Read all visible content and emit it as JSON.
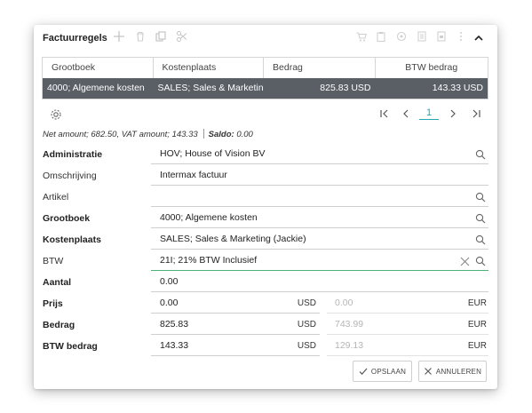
{
  "header": {
    "title": "Factuurregels",
    "left_icons": [
      "plus-icon",
      "trash-icon",
      "copy-icon",
      "scissors-icon"
    ],
    "right_icons": [
      "cart-icon",
      "clipboard-icon",
      "eye-icon",
      "note-icon",
      "doc-icon",
      "more-icon"
    ],
    "collapse_icon": "chevron-up-icon"
  },
  "grid": {
    "columns": [
      "Grootboek",
      "Kostenplaats",
      "Bedrag",
      "BTW bedrag"
    ],
    "rows": [
      {
        "grootboek": "4000; Algemene kosten",
        "kostenplaats": "SALES; Sales & Marketing (",
        "bedrag": "825.83 USD",
        "btw_bedrag": "143.33 USD"
      }
    ]
  },
  "pager": {
    "page": "1"
  },
  "summary": {
    "net": "Net amount; 682.50, VAT amount; 143.33",
    "saldo_label": "Saldo:",
    "saldo_value": "0.00"
  },
  "form": {
    "administratie": {
      "label": "Administratie",
      "value": "HOV; House of Vision BV"
    },
    "omschrijving": {
      "label": "Omschrijving",
      "value": "Intermax factuur"
    },
    "artikel": {
      "label": "Artikel",
      "value": ""
    },
    "grootboek": {
      "label": "Grootboek",
      "value": "4000; Algemene kosten"
    },
    "kostenplaats": {
      "label": "Kostenplaats",
      "value": "SALES; Sales & Marketing (Jackie)"
    },
    "btw": {
      "label": "BTW",
      "value": "21I; 21% BTW Inclusief"
    },
    "aantal": {
      "label": "Aantal",
      "value": "0.00"
    },
    "prijs": {
      "label": "Prijs",
      "value": "0.00",
      "currency": "USD",
      "value2": "0.00",
      "currency2": "EUR"
    },
    "bedrag": {
      "label": "Bedrag",
      "value": "825.83",
      "currency": "USD",
      "value2": "743.99",
      "currency2": "EUR"
    },
    "btw_bedrag": {
      "label": "BTW bedrag",
      "value": "143.33",
      "currency": "USD",
      "value2": "129.13",
      "currency2": "EUR"
    }
  },
  "buttons": {
    "save": "OPSLAAN",
    "cancel": "ANNULEREN"
  },
  "colors": {
    "accent": "#1ea8b8",
    "selected_row": "#5a5f66",
    "valid_field": "#4bb37a"
  }
}
